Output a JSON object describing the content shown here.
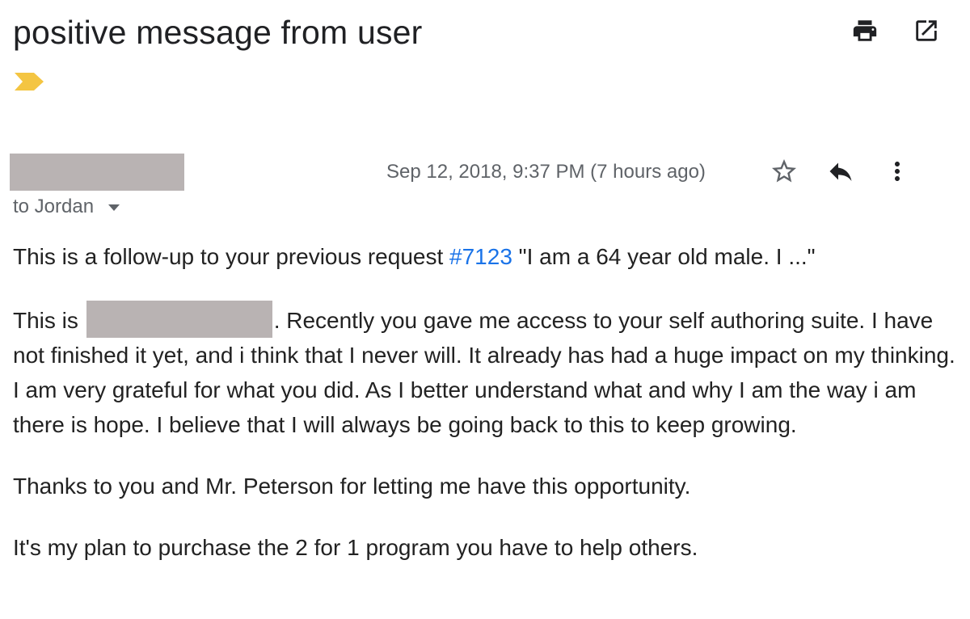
{
  "email": {
    "subject": "positive message from user",
    "recipient_line": "to Jordan",
    "date": "Sep 12, 2018, 9:37 PM (7 hours ago)",
    "body": {
      "p1_before_link": "This is a follow-up to your previous request ",
      "p1_link": "#7123",
      "p1_after_link": " \"I am a 64 year old male. I ...\"",
      "p2_before_redaction": "This is ",
      "p2_after_redaction": ". Recently you gave me access to your self authoring suite. I have not finished it yet, and i think that I never will. It already has had a huge impact on my thinking. I am very grateful for what you did. As I better understand what and why I am the way i am there is hope. I believe that I will always be going back to this to keep growing.",
      "p3": "Thanks to you and Mr. Peterson for letting me have this opportunity.",
      "p4": "It's my plan to purchase the 2 for 1 program you have to help others."
    }
  },
  "icons": {
    "print": "print-icon",
    "open_new_window": "open-in-new-window-icon",
    "importance_marker": "importance-marker-icon",
    "star": "star-icon",
    "reply": "reply-icon",
    "more": "more-vertical-icon",
    "recipient_dropdown": "chevron-down-icon"
  },
  "colors": {
    "importance_marker": "#f4c542",
    "link": "#1a73e8",
    "redaction": "#b9b3b3",
    "muted_text": "#5f6368"
  }
}
